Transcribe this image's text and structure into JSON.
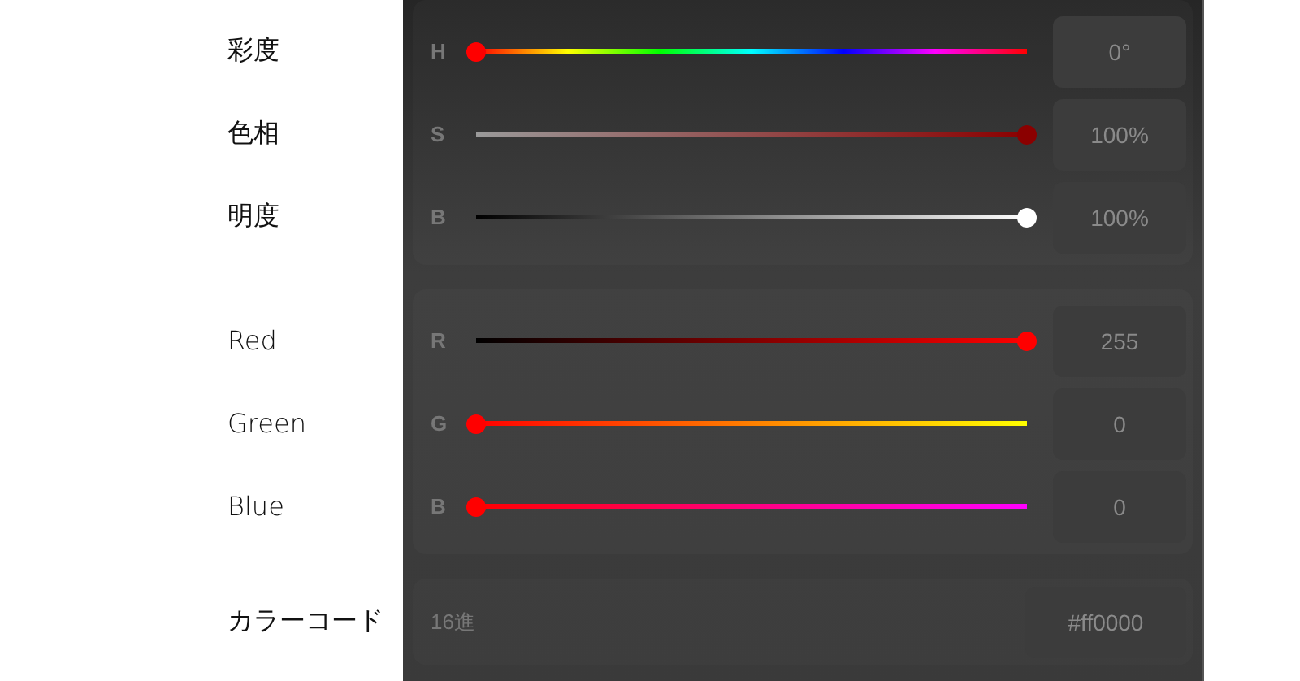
{
  "groups": [
    {
      "rows": [
        {
          "note": "彩度",
          "letter": "H",
          "kind": "hue",
          "level": 0,
          "color": "#ff0000",
          "value": "0°"
        },
        {
          "note": "色相",
          "letter": "S",
          "kind": "saturation",
          "level": 1,
          "color": "#8b0000",
          "value": "100%"
        },
        {
          "note": "明度",
          "letter": "B",
          "kind": "brightness",
          "level": 1,
          "color": "#ffffff",
          "value": "100%"
        }
      ]
    },
    {
      "rows": [
        {
          "note": "Red",
          "letter": "R",
          "kind": "red",
          "level": 1,
          "color": "#ff0000",
          "value": "255"
        },
        {
          "note": "Green",
          "letter": "G",
          "kind": "green",
          "level": 0,
          "color": "#ff0000",
          "value": "0"
        },
        {
          "note": "Blue",
          "letter": "B",
          "kind": "blue",
          "level": 0,
          "color": "#ff0000",
          "value": "0"
        }
      ]
    }
  ],
  "hex": {
    "note": "カラーコード",
    "label": "16進",
    "value": "#ff0000"
  }
}
